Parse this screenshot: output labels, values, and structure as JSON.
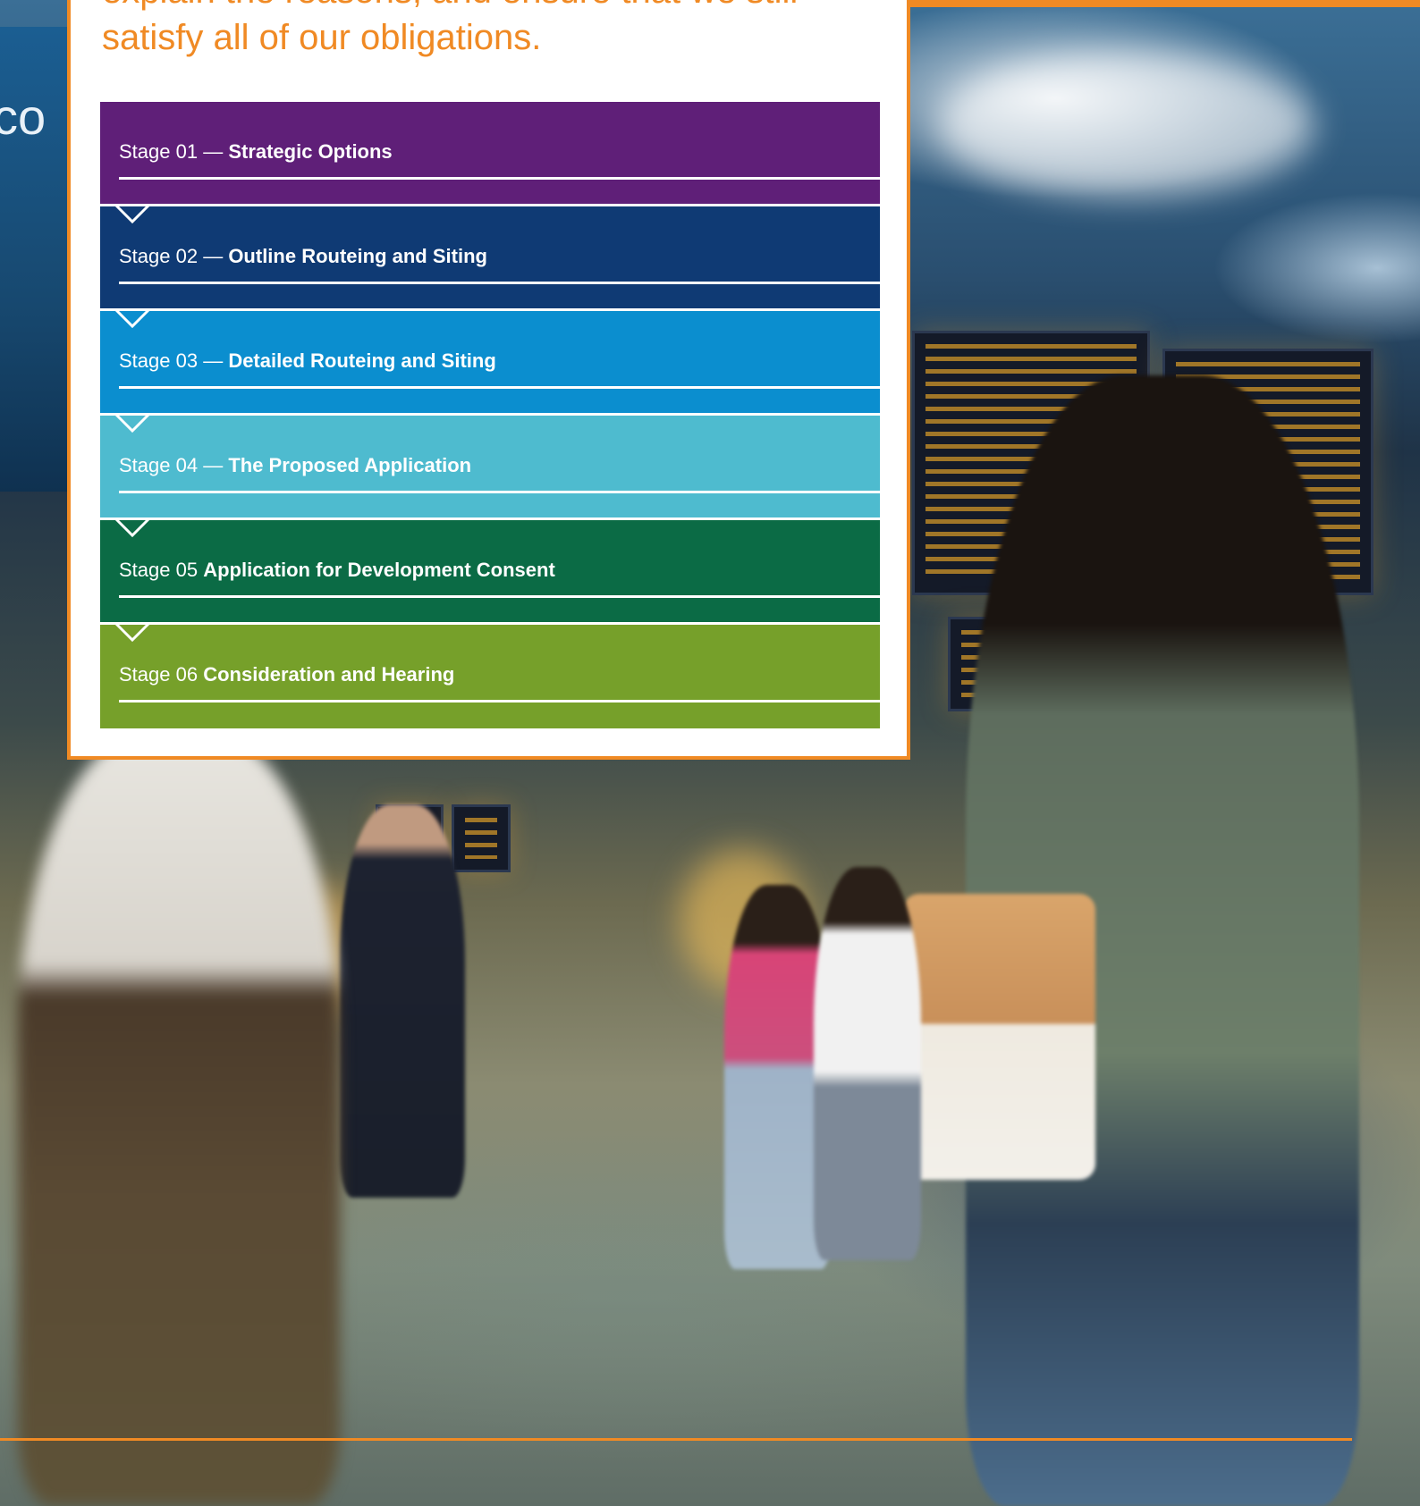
{
  "intro_text": "explain the reasons, and ensure that we still satisfy all of our obligations.",
  "background_sign_text": "co",
  "stages": [
    {
      "number": "Stage 01",
      "separator": " — ",
      "title": "Strategic Options",
      "color": "#5f1f78"
    },
    {
      "number": "Stage 02",
      "separator": " — ",
      "title": "Outline Routeing and Siting",
      "color": "#0f3a74"
    },
    {
      "number": "Stage 03",
      "separator": " — ",
      "title": "Detailed Routeing and Siting",
      "color": "#0b8ecf"
    },
    {
      "number": "Stage 04",
      "separator": " — ",
      "title": "The Proposed Application",
      "color": "#4ebbcf"
    },
    {
      "number": "Stage 05",
      "separator": " ",
      "title": "Application for Development Consent",
      "color": "#0b6b45"
    },
    {
      "number": "Stage 06",
      "separator": " ",
      "title": "Consideration and Hearing",
      "color": "#76a02a"
    }
  ],
  "accent_color": "#f08a24"
}
